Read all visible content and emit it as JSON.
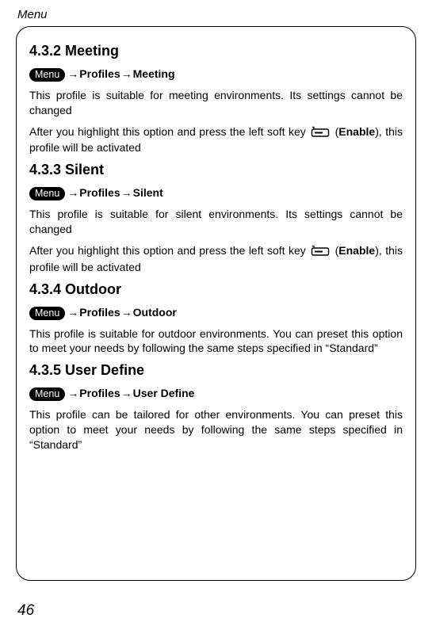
{
  "header": {
    "running_head": "Menu",
    "page_number": "46"
  },
  "nav": {
    "menu_badge": "Menu",
    "arrow": "→",
    "profiles": "Profiles",
    "enable": "Enable"
  },
  "sections": {
    "meeting": {
      "heading": "4.3.2 Meeting",
      "nav_target": "Meeting",
      "para1": "This profile is suitable for meeting environments. Its settings cannot be changed",
      "para2a": "After you highlight this option and press the left soft key ",
      "para2b": "), this profile will be activated"
    },
    "silent": {
      "heading": "4.3.3 Silent",
      "nav_target": "Silent",
      "para1": "This profile is suitable for silent environments. Its settings cannot be changed",
      "para2a": "After you highlight this option and press the left soft key ",
      "para2b": "), this profile will be activated"
    },
    "outdoor": {
      "heading": "4.3.4 Outdoor",
      "nav_target": "Outdoor",
      "para1": "This profile is suitable for outdoor environments. You can preset this option to meet your needs by following the same steps specified in “Standard”"
    },
    "userdefine": {
      "heading": "4.3.5 User Define",
      "nav_target": "User Define",
      "para1": "This profile can be tailored for other environments. You can preset this option to meet your needs by following the same steps specified in “Standard”"
    }
  }
}
